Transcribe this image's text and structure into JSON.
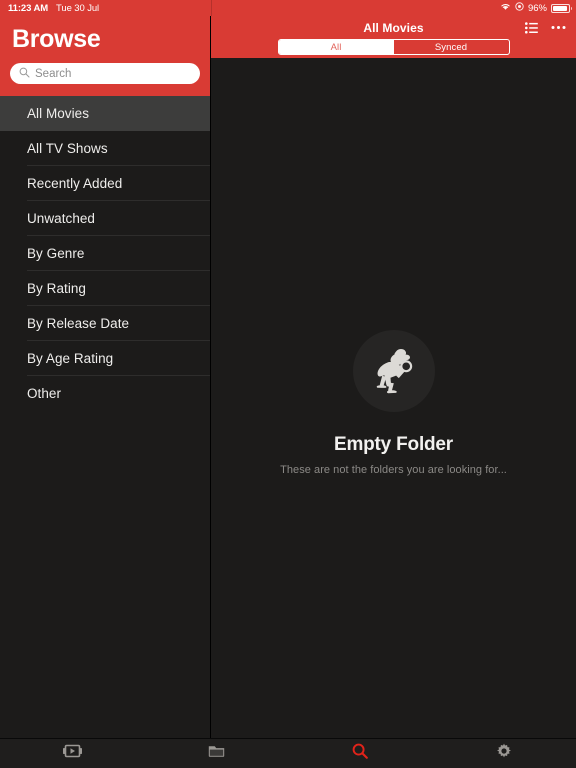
{
  "statusbar": {
    "time": "11:23 AM",
    "date": "Tue 30 Jul",
    "wifi_icon": "wifi-icon",
    "location_icon": "location-icon",
    "battery_percent": "96%",
    "battery_icon": "battery-icon"
  },
  "sidebar": {
    "title": "Browse",
    "search": {
      "placeholder": "Search",
      "value": "",
      "icon": "search-icon"
    },
    "items": [
      {
        "label": "All Movies",
        "selected": true
      },
      {
        "label": "All TV Shows",
        "selected": false
      },
      {
        "label": "Recently Added",
        "selected": false
      },
      {
        "label": "Unwatched",
        "selected": false
      },
      {
        "label": "By Genre",
        "selected": false
      },
      {
        "label": "By Rating",
        "selected": false
      },
      {
        "label": "By Release Date",
        "selected": false
      },
      {
        "label": "By Age Rating",
        "selected": false
      },
      {
        "label": "Other",
        "selected": false
      }
    ]
  },
  "navbar": {
    "title": "All Movies",
    "list_view_icon": "list-view-icon",
    "more_icon": "more-options-icon"
  },
  "segmented": {
    "options": [
      {
        "label": "All",
        "active": true
      },
      {
        "label": "Synced",
        "active": false
      }
    ]
  },
  "empty_state": {
    "illustration_icon": "detective-magnifier-icon",
    "title": "Empty Folder",
    "subtitle": "These are not the folders you are looking for..."
  },
  "tabbar": {
    "tabs": [
      {
        "name": "library-tab",
        "icon": "video-play-icon",
        "active": false
      },
      {
        "name": "folders-tab",
        "icon": "folder-icon",
        "active": false
      },
      {
        "name": "search-tab",
        "icon": "search-icon",
        "active": true
      },
      {
        "name": "settings-tab",
        "icon": "gear-icon",
        "active": false
      }
    ]
  },
  "colors": {
    "accent_red": "#d93b34",
    "active_red": "#e2231a",
    "background_dark": "#1c1b1a",
    "selected_row": "#3d3d3c"
  }
}
